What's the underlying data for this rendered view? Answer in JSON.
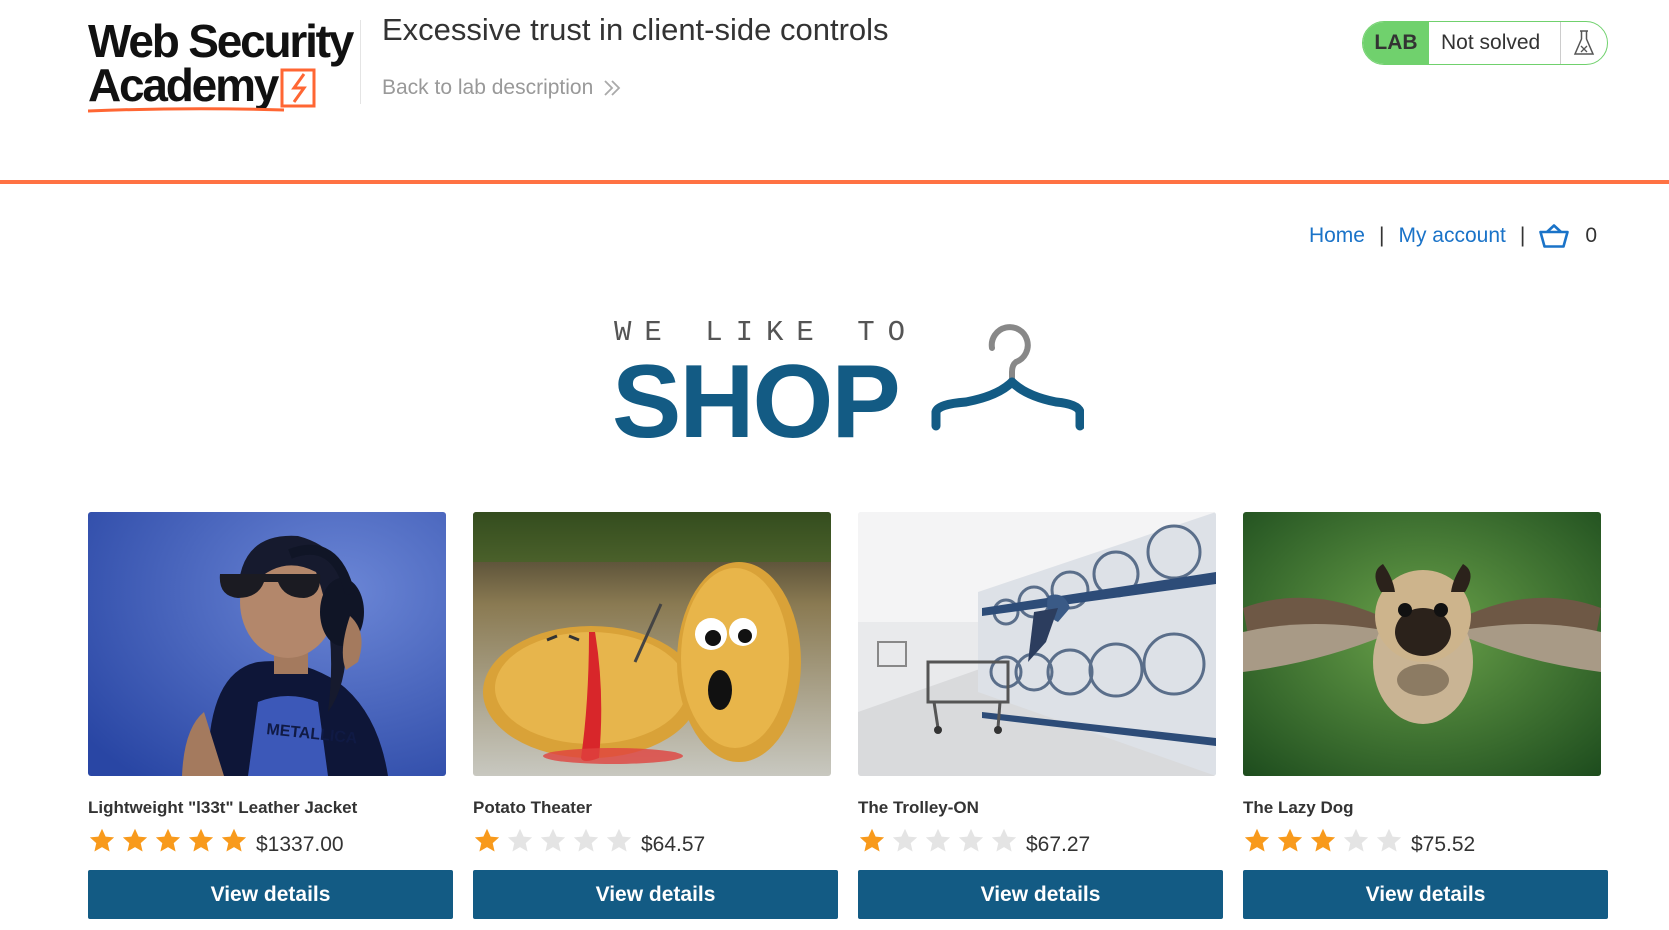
{
  "header": {
    "logo_line1": "Web Security",
    "logo_line2": "Academy",
    "lab_title": "Excessive trust in client-side controls",
    "back_link": "Back to lab description"
  },
  "lab_status": {
    "badge": "LAB",
    "status": "Not solved"
  },
  "nav": {
    "home": "Home",
    "separator": "|",
    "my_account": "My account",
    "cart_count": "0"
  },
  "banner": {
    "tagline": "WE LIKE TO",
    "headline": "SHOP"
  },
  "products": [
    {
      "name": "Lightweight \"l33t\" Leather Jacket",
      "rating": 5,
      "price": "$1337.00",
      "button": "View details"
    },
    {
      "name": "Potato Theater",
      "rating": 1,
      "price": "$64.57",
      "button": "View details"
    },
    {
      "name": "The Trolley-ON",
      "rating": 1,
      "price": "$67.27",
      "button": "View details"
    },
    {
      "name": "The Lazy Dog",
      "rating": 3,
      "price": "$75.52",
      "button": "View details"
    }
  ],
  "colors": {
    "accent_orange": "#ff6633",
    "brand_blue": "#135b84",
    "link_blue": "#1a73c8",
    "lab_green": "#70d16d",
    "star_on": "#f89a1c",
    "star_off": "#e4e4e4"
  }
}
